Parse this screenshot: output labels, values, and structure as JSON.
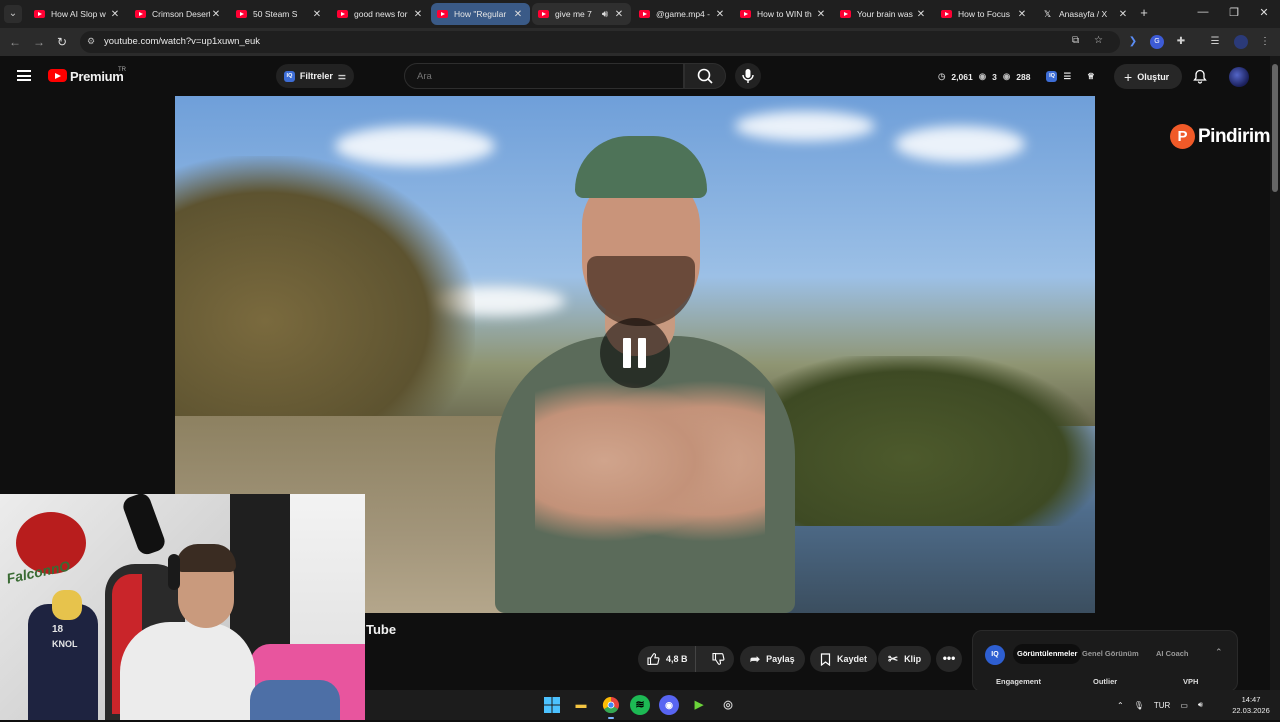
{
  "browser": {
    "tabs": [
      {
        "title": "How AI Slop w",
        "favicon": "youtube-icon"
      },
      {
        "title": "Crimson Desert",
        "favicon": "youtube-icon"
      },
      {
        "title": "50 Steam S",
        "favicon": "youtube-icon"
      },
      {
        "title": "good news for",
        "favicon": "youtube-icon"
      },
      {
        "title": "How \"Regular",
        "favicon": "youtube-icon",
        "active": true
      },
      {
        "title": "give me 7",
        "favicon": "youtube-icon",
        "audio": true
      },
      {
        "title": "@game.mp4 -",
        "favicon": "youtube-icon"
      },
      {
        "title": "How to WIN th",
        "favicon": "youtube-icon"
      },
      {
        "title": "Your brain was",
        "favicon": "youtube-icon"
      },
      {
        "title": "How to Focus",
        "favicon": "youtube-icon"
      },
      {
        "title": "Anasayfa / X",
        "favicon": "x-icon"
      }
    ],
    "new_tab": "+",
    "url": "youtube.com/watch?v=up1xuwn_euk"
  },
  "youtube": {
    "brand": "Premium",
    "region": "TR",
    "filters_label": "Filtreler",
    "search_placeholder": "Ara",
    "stats": {
      "views": "2,061",
      "comments": "3",
      "watching": "288"
    },
    "create_label": "Oluştur"
  },
  "watermark": "Pindirim",
  "video": {
    "title": "Tube",
    "likes": "4,8 B",
    "share_label": "Paylaş",
    "save_label": "Kaydet",
    "clip_label": "Klip",
    "more": "•••"
  },
  "extension": {
    "badge": "IQ",
    "tabs": [
      "Görüntülenmeler",
      "Genel Görünüm",
      "AI Coach"
    ],
    "columns": [
      "Engagement",
      "Outlier",
      "VPH"
    ]
  },
  "webcam": {
    "logo_text": "FalconnO",
    "jersey_number": "18",
    "jersey_text": "KNOL"
  },
  "taskbar": {
    "language": "TUR",
    "time": "14:47",
    "date": "22.03.2026"
  },
  "colors": {
    "accent_tab": "#3a5a87",
    "youtube_red": "#ff0000",
    "iq_blue": "#3d6dd6",
    "watermark_orange": "#f05a28"
  }
}
